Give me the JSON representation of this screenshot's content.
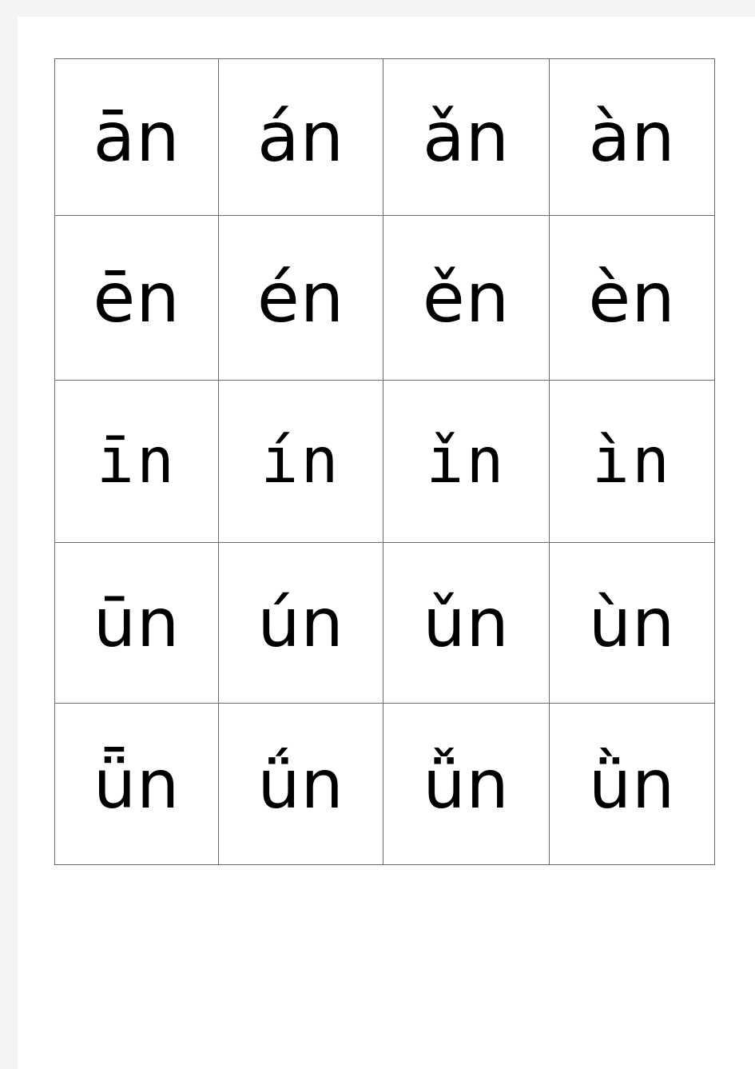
{
  "document": {
    "title": "Pinyin final -n tone chart",
    "page_background": "#f4f4f4",
    "sheet_background": "#ffffff",
    "text_color": "#000000",
    "border_color": "#6b6b6b"
  },
  "table": {
    "name": "pinyin-tone-grid",
    "columns": 4,
    "rows": 5,
    "column_meaning": [
      "tone-1-macron",
      "tone-2-acute",
      "tone-3-caron",
      "tone-4-grave"
    ],
    "cells": [
      [
        "ān",
        "án",
        "ǎn",
        "àn"
      ],
      [
        "ēn",
        "én",
        "ěn",
        "èn"
      ],
      [
        "īn",
        "ín",
        "ǐn",
        "ìn"
      ],
      [
        "ūn",
        "ún",
        "ǔn",
        "ùn"
      ],
      [
        "ǖn",
        "ǘn",
        "ǚn",
        "ǜn"
      ]
    ]
  }
}
